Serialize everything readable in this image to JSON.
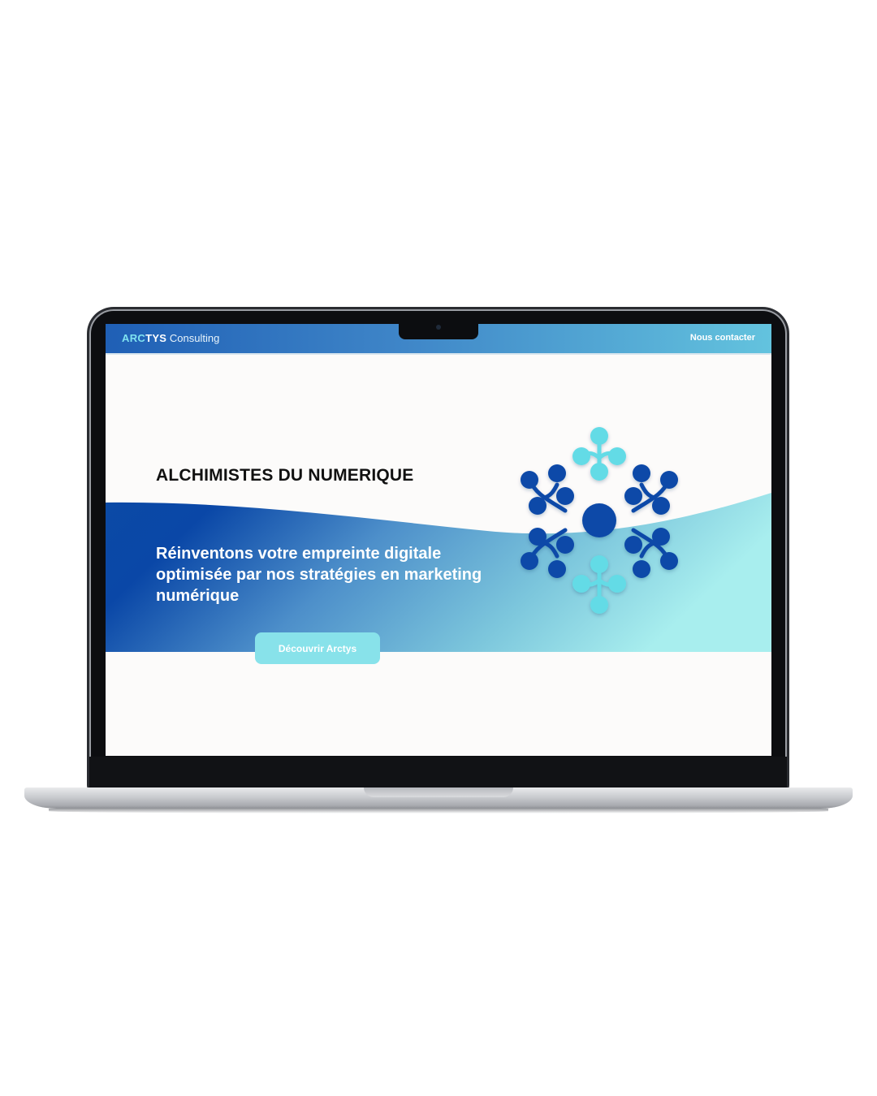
{
  "brand": {
    "logo_arc": "ARC",
    "logo_tys": "TYS",
    "logo_suffix": " Consulting"
  },
  "nav": {
    "contact_label": "Nous contacter"
  },
  "hero": {
    "headline": "ALCHIMISTES DU NUMERIQUE",
    "subtext": "Réinventons votre empreinte digitale optimisée par nos stratégies en marketing numérique",
    "cta_label": "Découvrir Arctys",
    "graphic_icon": "molecule-network-icon"
  },
  "colors": {
    "dark_blue": "#0a49a8",
    "mid_blue": "#3f86c8",
    "cyan": "#63dbe6",
    "light_cyan": "#a7eced",
    "button": "#88e2ea"
  }
}
